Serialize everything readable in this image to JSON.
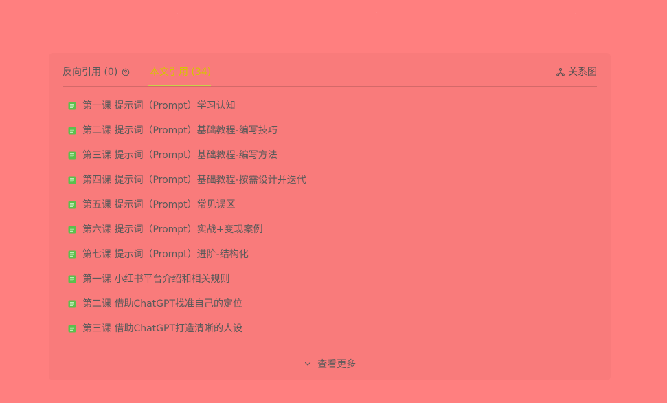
{
  "tabs": {
    "backlinks_label": "反向引用 (0)",
    "references_label": "本文引用 (34)",
    "graph_label": "关系图"
  },
  "items": [
    {
      "label": "第一课 提示词（Prompt）学习认知"
    },
    {
      "label": "第二课 提示词（Prompt）基础教程-编写技巧"
    },
    {
      "label": "第三课 提示词（Prompt）基础教程-编写方法"
    },
    {
      "label": "第四课 提示词（Prompt）基础教程-按需设计并迭代"
    },
    {
      "label": "第五课 提示词（Prompt）常见误区"
    },
    {
      "label": "第六课 提示词（Prompt）实战+变现案例"
    },
    {
      "label": "第七课 提示词（Prompt）进阶-结构化"
    },
    {
      "label": "第一课 小红书平台介绍和相关规则"
    },
    {
      "label": "第二课 借助ChatGPT找准自己的定位"
    },
    {
      "label": "第三课 借助ChatGPT打造清晰的人设"
    }
  ],
  "more_label": "查看更多",
  "colors": {
    "background": "#ff7f7f",
    "panel": "#f97b7b",
    "active_tab": "#d6c400",
    "underline": "#c9d24a",
    "doc_icon": "#5cbf4d"
  },
  "icons": {
    "help": "question-circle-icon",
    "graph": "relationship-graph-icon",
    "document": "document-icon",
    "more": "chevron-down-icon"
  }
}
